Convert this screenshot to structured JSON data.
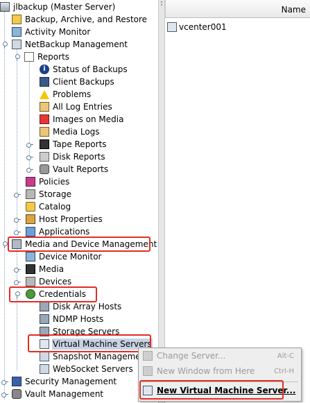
{
  "tree": {
    "root": "jlbackup (Master Server)",
    "items": [
      {
        "label": "Backup, Archive, and Restore",
        "icon": "backup-icon"
      },
      {
        "label": "Activity Monitor",
        "icon": "activity-monitor-icon"
      },
      {
        "label": "NetBackup Management",
        "icon": "netbackup-icon"
      },
      {
        "label": "Reports",
        "icon": "reports-icon"
      },
      {
        "label": "Status of Backups",
        "icon": "info-icon"
      },
      {
        "label": "Client Backups",
        "icon": "client-backups-icon"
      },
      {
        "label": "Problems",
        "icon": "warning-icon"
      },
      {
        "label": "All Log Entries",
        "icon": "log-entries-icon"
      },
      {
        "label": "Images on Media",
        "icon": "images-on-media-icon"
      },
      {
        "label": "Media Logs",
        "icon": "media-logs-icon"
      },
      {
        "label": "Tape Reports",
        "icon": "tape-icon"
      },
      {
        "label": "Disk Reports",
        "icon": "disk-icon"
      },
      {
        "label": "Vault Reports",
        "icon": "vault-icon"
      },
      {
        "label": "Policies",
        "icon": "policies-icon"
      },
      {
        "label": "Storage",
        "icon": "storage-icon"
      },
      {
        "label": "Catalog",
        "icon": "catalog-icon"
      },
      {
        "label": "Host Properties",
        "icon": "host-properties-icon"
      },
      {
        "label": "Applications",
        "icon": "applications-icon"
      },
      {
        "label": "Media and Device Management",
        "icon": "media-device-icon"
      },
      {
        "label": "Device Monitor",
        "icon": "device-monitor-icon"
      },
      {
        "label": "Media",
        "icon": "media-icon"
      },
      {
        "label": "Devices",
        "icon": "devices-icon"
      },
      {
        "label": "Credentials",
        "icon": "credentials-icon"
      },
      {
        "label": "Disk Array Hosts",
        "icon": "disk-array-icon"
      },
      {
        "label": "NDMP Hosts",
        "icon": "ndmp-icon"
      },
      {
        "label": "Storage Servers",
        "icon": "storage-servers-icon"
      },
      {
        "label": "Virtual Machine Servers",
        "icon": "vm-server-icon"
      },
      {
        "label": "Snapshot Management",
        "icon": "snapshot-icon"
      },
      {
        "label": "WebSocket Servers",
        "icon": "websocket-icon"
      },
      {
        "label": "Security Management",
        "icon": "security-icon"
      },
      {
        "label": "Vault Management",
        "icon": "vault-management-icon"
      }
    ]
  },
  "right_pane": {
    "column_header": "Name",
    "rows": [
      {
        "label": "vcenter001",
        "icon": "vcenter-icon"
      }
    ]
  },
  "context_menu": {
    "items": [
      {
        "label": "Change Server...",
        "shortcut": "Alt-C",
        "enabled": false
      },
      {
        "label": "New Window from Here",
        "shortcut": "Ctrl-H",
        "enabled": false
      },
      {
        "label": "New Virtual Machine Server...",
        "shortcut": "",
        "enabled": true
      }
    ]
  },
  "colors": {
    "highlight": "#e52b24",
    "selection": "#c7d3e3"
  }
}
